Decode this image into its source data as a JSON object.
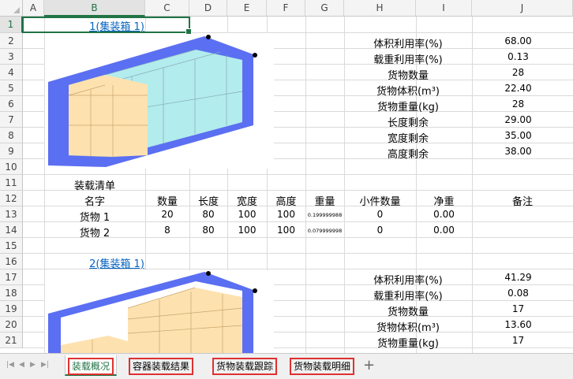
{
  "columns": [
    "A",
    "B",
    "C",
    "D",
    "E",
    "F",
    "G",
    "H",
    "I",
    "J"
  ],
  "rows": [
    "1",
    "2",
    "3",
    "4",
    "5",
    "6",
    "7",
    "8",
    "9",
    "10",
    "11",
    "12",
    "13",
    "14",
    "15",
    "16",
    "17",
    "18",
    "19",
    "20",
    "21"
  ],
  "selected_column": "B",
  "selected_row": "1",
  "container1": {
    "link": "1(集装箱 1)",
    "stats": [
      {
        "label": "体积利用率(%)",
        "value": "68.00"
      },
      {
        "label": "载重利用率(%)",
        "value": "0.13"
      },
      {
        "label": "货物数量",
        "value": "28"
      },
      {
        "label": "货物体积(m³)",
        "value": "22.40"
      },
      {
        "label": "货物重量(kg)",
        "value": "28"
      },
      {
        "label": "长度剩余",
        "value": "29.00"
      },
      {
        "label": "宽度剩余",
        "value": "35.00"
      },
      {
        "label": "高度剩余",
        "value": "38.00"
      }
    ]
  },
  "manifest": {
    "title": "装载清单",
    "headers": [
      "名字",
      "数量",
      "长度",
      "宽度",
      "高度",
      "重量",
      "小件数量",
      "净重",
      "备注"
    ],
    "rows": [
      [
        "货物 1",
        "20",
        "80",
        "100",
        "100",
        "0.199999988",
        "0",
        "0.00",
        ""
      ],
      [
        "货物 2",
        "8",
        "80",
        "100",
        "100",
        "0.079999998",
        "0",
        "0.00",
        ""
      ]
    ]
  },
  "container2": {
    "link": "2(集装箱 1)",
    "stats": [
      {
        "label": "体积利用率(%)",
        "value": "41.29"
      },
      {
        "label": "载重利用率(%)",
        "value": "0.08"
      },
      {
        "label": "货物数量",
        "value": "17"
      },
      {
        "label": "货物体积(m³)",
        "value": "13.60"
      },
      {
        "label": "货物重量(kg)",
        "value": "17"
      }
    ]
  },
  "sheet_tabs": [
    "装载概况",
    "容器装载结果",
    "货物装载跟踪",
    "货物装载明细"
  ],
  "active_tab": "装载概况",
  "add_sheet": "+",
  "colors": {
    "container": "#5b6ff2",
    "cargo1": "#fde2b0",
    "cargo2": "#b2ecec",
    "accent": "#217346",
    "tab_outline": "#e03030"
  }
}
